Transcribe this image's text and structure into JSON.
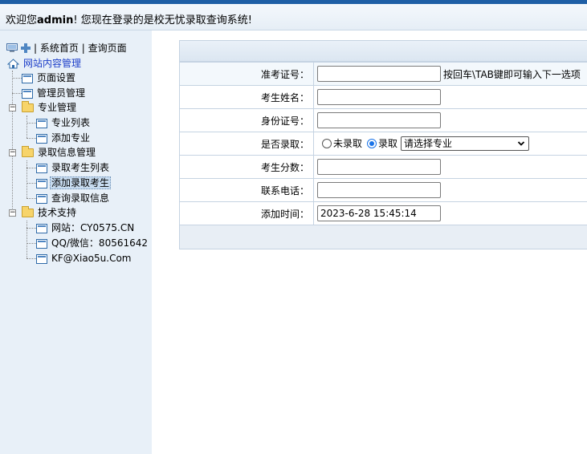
{
  "header": {
    "welcome_prefix": "欢迎您",
    "user": "admin",
    "welcome_suffix": "! 您现在登录的是校无忧录取查询系统!"
  },
  "sidebar": {
    "top_links": {
      "sep1": "|",
      "home": "系统首页",
      "sep2": "|",
      "query": "查询页面"
    },
    "tree": {
      "root": "网站内容管理",
      "page_settings": "页面设置",
      "admin_manage": "管理员管理",
      "major_manage": "专业管理",
      "major_list": "专业列表",
      "add_major": "添加专业",
      "admission_manage": "录取信息管理",
      "admitted_list": "录取考生列表",
      "add_admitted": "添加录取考生",
      "query_admission": "查询录取信息",
      "tech_support": "技术支持",
      "website": "网站：CY0575.CN",
      "qq": "QQ/微信：80561642",
      "email": "KF@Xiao5u.Com"
    }
  },
  "form": {
    "ticket_label": "准考证号：",
    "ticket_value": "",
    "ticket_hint": "按回车\\TAB键即可输入下一选项",
    "name_label": "考生姓名：",
    "name_value": "",
    "id_label": "身份证号：",
    "id_value": "",
    "admitted_label": "是否录取：",
    "opt_not_admitted": "未录取",
    "opt_admitted": "录取",
    "selected_option": "录取",
    "major_select": "请选择专业",
    "score_label": "考生分数：",
    "score_value": "",
    "phone_label": "联系电话：",
    "phone_value": "",
    "time_label": "添加时间：",
    "time_value": "2023-6-28 15:45:14"
  },
  "colors": {
    "topbar": "#1f5fa6",
    "sidebar_bg": "#e8f0f8",
    "link_blue": "#0000ee"
  }
}
